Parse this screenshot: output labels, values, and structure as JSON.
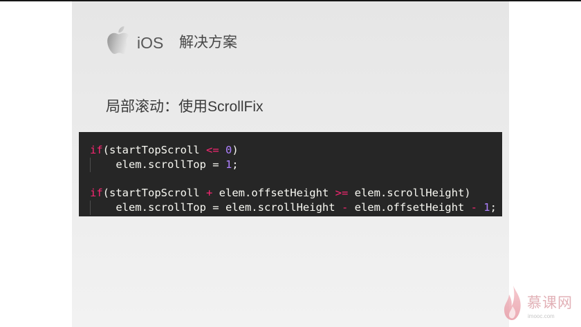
{
  "slide": {
    "platform_logo": "apple-icon",
    "platform": "iOS",
    "heading": "解决方案",
    "subtitle": "局部滚动：使用ScrollFix"
  },
  "code": {
    "colors": {
      "background": "#262626",
      "plain": "#f8f8f2",
      "keyword": "#f92672",
      "operator": "#f92672",
      "number": "#ae81ff",
      "indent_guide": "#4d4d4d"
    },
    "lines": [
      {
        "indent": false,
        "tokens": [
          {
            "keyword": "if"
          },
          {
            "plain": "(startTopScroll "
          },
          {
            "operator": "<="
          },
          {
            "plain": " "
          },
          {
            "number": "0"
          },
          {
            "plain": ")"
          }
        ]
      },
      {
        "indent": true,
        "tokens": [
          {
            "plain": "elem.scrollTop = "
          },
          {
            "number": "1"
          },
          {
            "plain": ";"
          }
        ]
      },
      {
        "indent": false,
        "tokens": []
      },
      {
        "indent": false,
        "tokens": [
          {
            "keyword": "if"
          },
          {
            "plain": "(startTopScroll "
          },
          {
            "operator": "+"
          },
          {
            "plain": " elem.offsetHeight "
          },
          {
            "operator": ">="
          },
          {
            "plain": " elem.scrollHeight)"
          }
        ]
      },
      {
        "indent": true,
        "tokens": [
          {
            "plain": "elem.scrollTop = elem.scrollHeight "
          },
          {
            "operator": "-"
          },
          {
            "plain": " elem.offsetHeight "
          },
          {
            "operator": "-"
          },
          {
            "plain": " "
          },
          {
            "number": "1"
          },
          {
            "plain": ";"
          }
        ]
      }
    ]
  },
  "watermark": {
    "logo": "imooc-flame-icon",
    "name": "慕课网",
    "domain": "imooc.com"
  }
}
